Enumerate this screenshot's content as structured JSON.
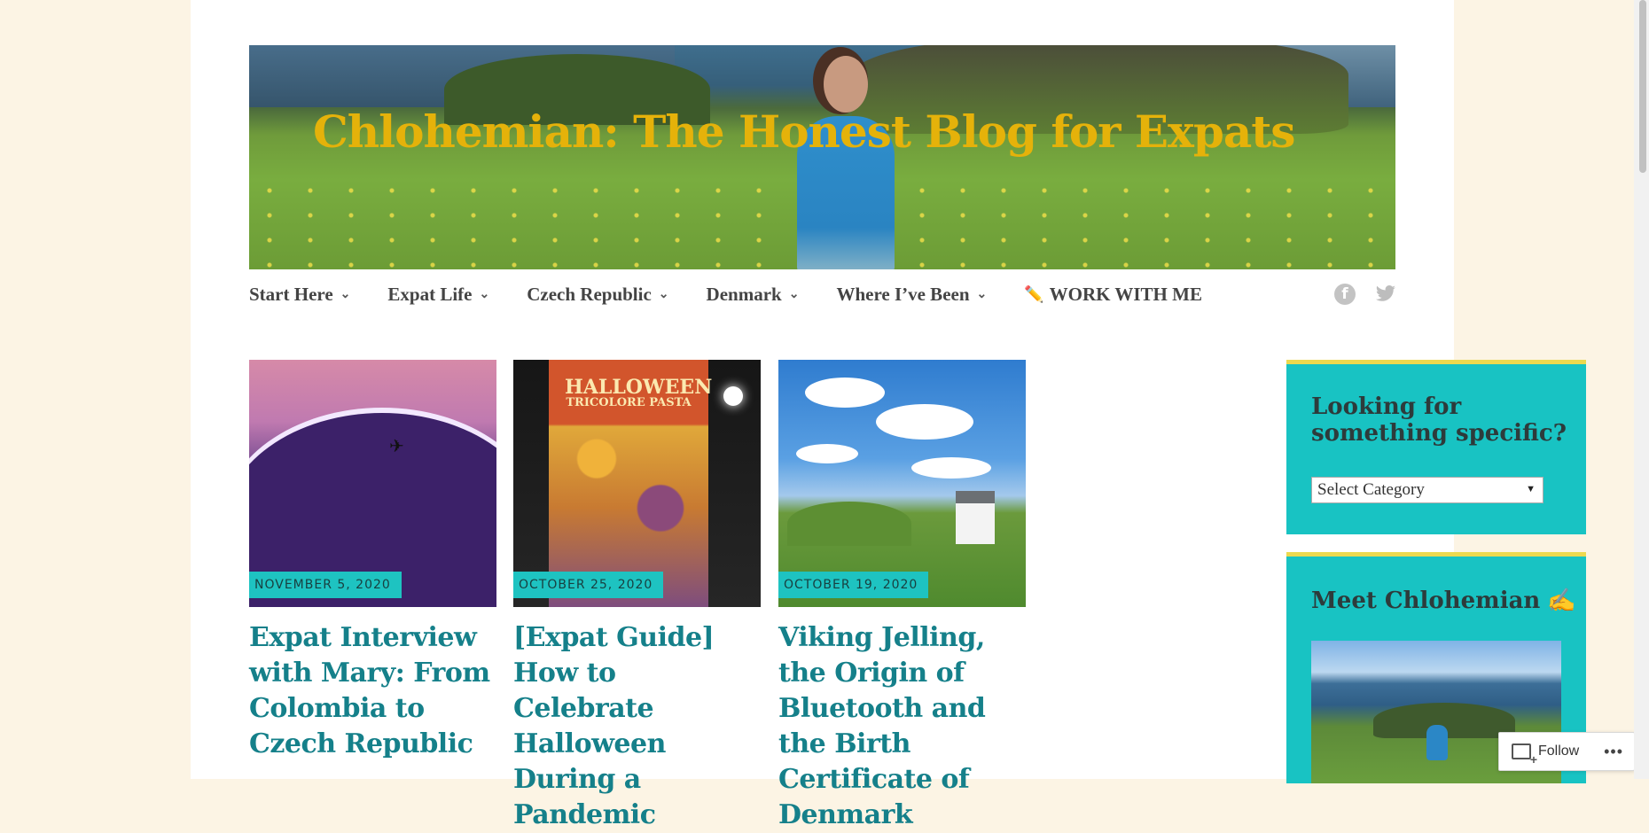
{
  "site": {
    "title": "Chlohemian: The Honest Blog for Expats"
  },
  "nav": {
    "items": [
      {
        "label": "Start Here",
        "has_dropdown": true
      },
      {
        "label": "Expat Life",
        "has_dropdown": true
      },
      {
        "label": "Czech Republic",
        "has_dropdown": true
      },
      {
        "label": "Denmark",
        "has_dropdown": true
      },
      {
        "label": "Where I’ve Been",
        "has_dropdown": true
      },
      {
        "label": "WORK WITH ME",
        "icon": "pencil-icon",
        "has_dropdown": false
      }
    ],
    "social": [
      "facebook-icon",
      "twitter-icon"
    ]
  },
  "posts": [
    {
      "date": "NOVEMBER 5, 2020",
      "title": "Expat Interview with Mary: From Colombia to Czech Republic"
    },
    {
      "date": "OCTOBER 25, 2020",
      "title": "[Expat Guide] How to Celebrate Halloween During a Pandemic"
    },
    {
      "date": "OCTOBER 19, 2020",
      "title": "Viking Jelling, the Origin of Bluetooth and the Birth Certificate of Denmark"
    }
  ],
  "thumbs": {
    "halloween_label": "HALLOWEEN",
    "halloween_sub": "TRICOLORE PASTA"
  },
  "sidebar": {
    "search_widget": {
      "title": "Looking for something specific?",
      "select_value": "Select Category"
    },
    "about_widget": {
      "title": "Meet Chlohemian",
      "emoji": "✍"
    }
  },
  "follow": {
    "label": "Follow",
    "more": "•••"
  },
  "colors": {
    "accent": "#18c3c3",
    "title_gold": "#e5b20a",
    "post_title": "#15808a",
    "widget_border": "#ecd94f",
    "background": "#fcf4e4"
  }
}
